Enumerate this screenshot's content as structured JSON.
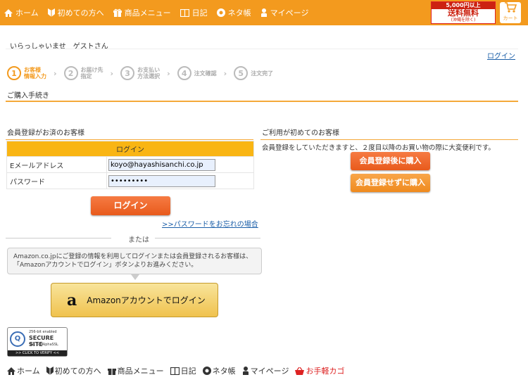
{
  "nav": {
    "items": [
      {
        "label": "ホーム",
        "icon": "home-icon"
      },
      {
        "label": "初めての方へ",
        "icon": "beginner-icon"
      },
      {
        "label": "商品メニュー",
        "icon": "gift-icon"
      },
      {
        "label": "日記",
        "icon": "book-icon"
      },
      {
        "label": "ネタ帳",
        "icon": "note-icon"
      },
      {
        "label": "マイページ",
        "icon": "user-icon"
      }
    ],
    "freeship": {
      "line1": "5,000円以上",
      "line2": "送料無料",
      "line3": "(沖縄を除く)"
    },
    "cart_label": "カート"
  },
  "header": {
    "welcome": "いらっしゃいませ　ゲストさん",
    "login_link": "ログイン"
  },
  "steps": [
    {
      "num": "1",
      "label1": "お客様",
      "label2": "情報入力",
      "active": true
    },
    {
      "num": "2",
      "label1": "お届け先",
      "label2": "指定",
      "active": false
    },
    {
      "num": "3",
      "label1": "お支払い",
      "label2": "方法選択",
      "active": false
    },
    {
      "num": "4",
      "label1": "注文確認",
      "label2": "",
      "active": false
    },
    {
      "num": "5",
      "label1": "注文完了",
      "label2": "",
      "active": false
    }
  ],
  "section_title": "ご購入手続き",
  "member": {
    "heading": "会員登録がお済のお客様",
    "table_head": "ログイン",
    "email_label": "Eメールアドレス",
    "email_value": "koyo@hayashisanchi.co.jp",
    "password_label": "パスワード",
    "password_value": "•••••••••",
    "login_button": "ログイン",
    "forgot_link": ">>パスワードをお忘れの場合",
    "or_text": "または",
    "amazon_note_1": "Amazon.co.jpにご登録の情報を利用してログインまたは会員登録されるお客様は、",
    "amazon_note_2": "「Amazonアカウントでログイン」ボタンよりお進みください。",
    "amazon_button_logo": "a",
    "amazon_button_text": "Amazonアカウントでログイン"
  },
  "ssl_badge": {
    "line1": "256-bit enabled",
    "line2": "SECURE SITE",
    "line3": "SSL by AlphaSSL",
    "line4": ">> CLICK TO VERIFY <<"
  },
  "guest": {
    "heading": "ご利用が初めてのお客様",
    "desc": "会員登録をしていただきますと、２度目以降のお買い物の際に大変便利です。",
    "register_button": "会員登録後に購入",
    "guest_button": "会員登録せずに購入"
  },
  "footer": {
    "items": [
      {
        "label": "ホーム",
        "icon": "home-icon"
      },
      {
        "label": "初めての方へ",
        "icon": "beginner-icon"
      },
      {
        "label": "商品メニュー",
        "icon": "gift-icon"
      },
      {
        "label": "日記",
        "icon": "book-icon"
      },
      {
        "label": "ネタ帳",
        "icon": "note-icon"
      },
      {
        "label": "マイページ",
        "icon": "user-icon"
      },
      {
        "label": "お手軽カゴ",
        "icon": "basket-icon"
      }
    ]
  },
  "colors": {
    "accent": "#f39a1e",
    "button": "#e85a1c",
    "table_head": "#f9b514",
    "link": "#1a5ea8"
  }
}
